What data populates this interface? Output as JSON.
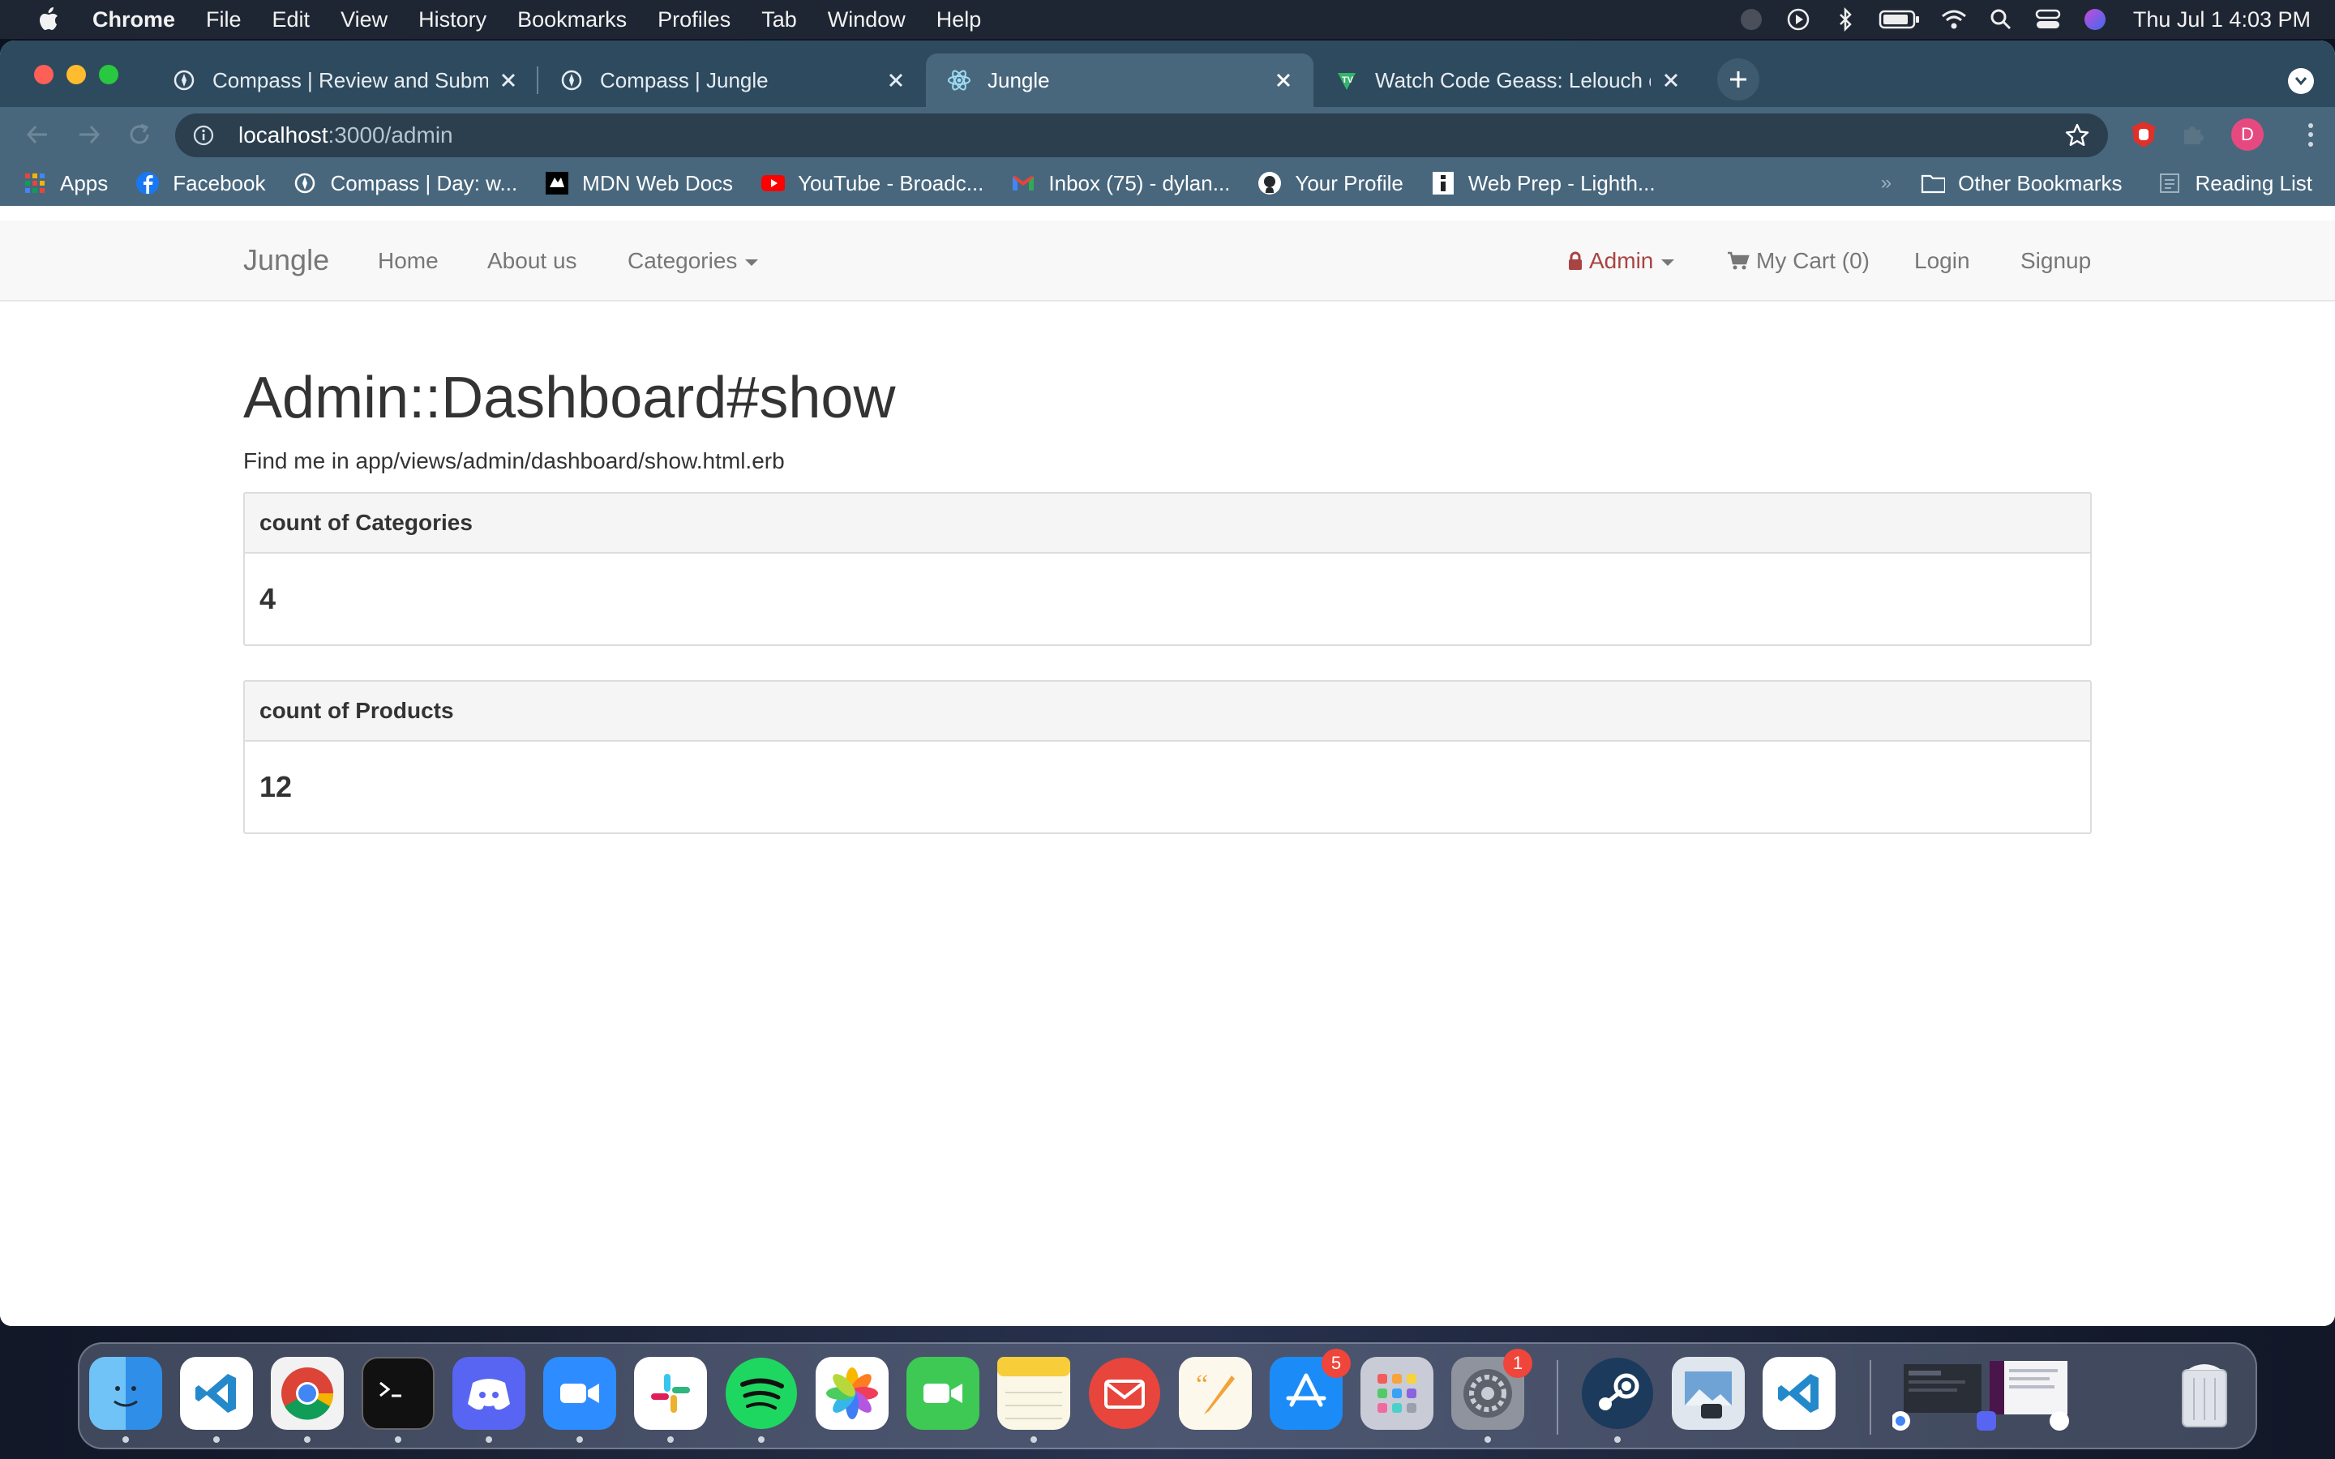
{
  "menubar": {
    "app_name": "Chrome",
    "items": [
      "File",
      "Edit",
      "View",
      "History",
      "Bookmarks",
      "Profiles",
      "Tab",
      "Window",
      "Help"
    ],
    "clock": "Thu Jul 1  4:03 PM"
  },
  "browser": {
    "tabs": [
      {
        "title": "Compass | Review and Submit",
        "icon": "compass-icon",
        "active": false
      },
      {
        "title": "Compass | Jungle",
        "icon": "compass-icon",
        "active": false
      },
      {
        "title": "Jungle",
        "icon": "react-icon",
        "active": true
      },
      {
        "title": "Watch Code Geass: Lelouch of",
        "icon": "tv-icon",
        "active": false
      }
    ],
    "url_host": "localhost",
    "url_path": ":3000/admin",
    "profile_initial": "D",
    "bookmarks": [
      {
        "label": "Apps",
        "icon": "apps-grid-icon"
      },
      {
        "label": "Facebook",
        "icon": "facebook-icon"
      },
      {
        "label": "Compass | Day: w...",
        "icon": "compass-icon"
      },
      {
        "label": "MDN Web Docs",
        "icon": "mdn-icon"
      },
      {
        "label": "YouTube - Broadc...",
        "icon": "youtube-icon"
      },
      {
        "label": "Inbox (75) - dylan...",
        "icon": "gmail-icon"
      },
      {
        "label": "Your Profile",
        "icon": "github-icon"
      },
      {
        "label": "Web Prep - Lighth...",
        "icon": "lighthouse-icon"
      }
    ],
    "other_bookmarks": "Other Bookmarks",
    "reading_list": "Reading List"
  },
  "site": {
    "brand": "Jungle",
    "nav": {
      "home": "Home",
      "about": "About us",
      "categories": "Categories",
      "admin": "Admin",
      "cart": "My Cart (0)",
      "login": "Login",
      "signup": "Signup"
    },
    "page_title": "Admin::Dashboard#show",
    "hint": "Find me in app/views/admin/dashboard/show.html.erb",
    "panels": [
      {
        "heading": "count of Categories",
        "value": "4"
      },
      {
        "heading": "count of Products",
        "value": "12"
      }
    ]
  },
  "colors": {
    "admin_link": "#a94442",
    "tab_active": "#48677d",
    "tabstrip": "#2e4a5e"
  },
  "dock": {
    "apps": [
      "finder-icon",
      "vscode-icon",
      "chrome-icon",
      "terminal-icon",
      "discord-icon",
      "zoom-icon",
      "slack-icon",
      "spotify-icon",
      "photos-icon",
      "facetime-icon",
      "notes-icon",
      "mail-icon",
      "pages-icon",
      "app-store-icon",
      "launchpad-icon",
      "system-preferences-icon",
      "steam-icon",
      "preview-icon",
      "vscode-icon",
      "trash-icon"
    ],
    "badges": {
      "app_store": "5",
      "system_preferences": "1"
    }
  }
}
